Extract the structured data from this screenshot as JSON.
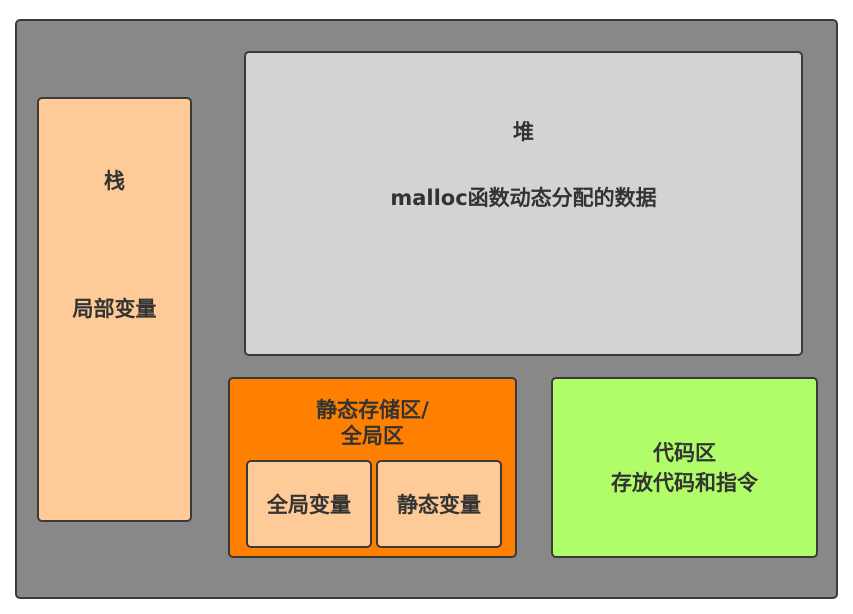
{
  "colors": {
    "outer": "#888888",
    "stack": "#fecb98",
    "heap": "#d3d3d3",
    "static": "#ff8000",
    "code": "#b1fd69",
    "border": "#3a3a3a",
    "text": "#333333"
  },
  "memory": {
    "stack": {
      "title": "栈",
      "desc": "局部变量"
    },
    "heap": {
      "title": "堆",
      "desc": "malloc函数动态分配的数据"
    },
    "static_area": {
      "title_line1": "静态存储区/",
      "title_line2": "全局区",
      "global_vars": "全局变量",
      "static_vars": "静态变量"
    },
    "code_area": {
      "title": "代码区",
      "desc": "存放代码和指令"
    }
  }
}
